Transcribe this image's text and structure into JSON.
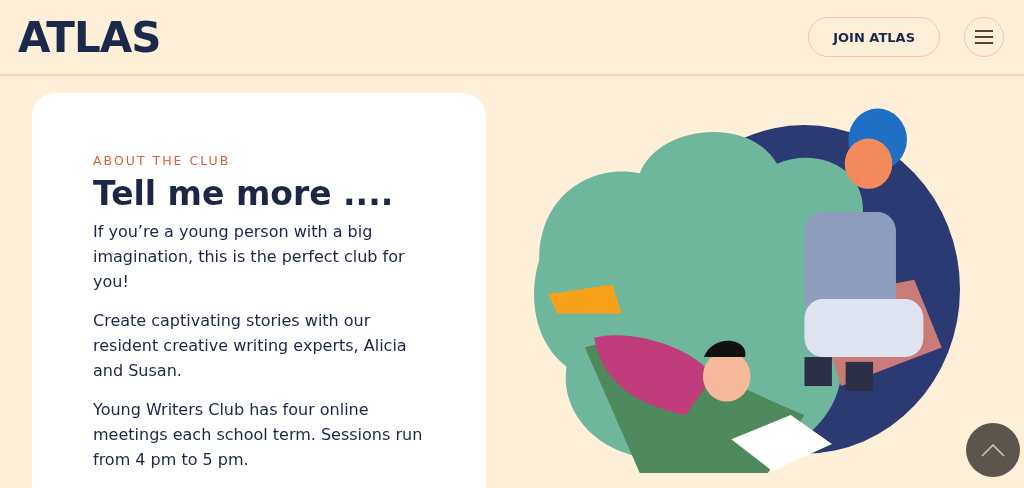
{
  "header": {
    "logo": "ATLAS",
    "join_button": "JOIN ATLAS"
  },
  "about": {
    "eyebrow": "ABOUT THE CLUB",
    "heading": "Tell me more ....",
    "paragraphs": [
      "If you’re a young person with a big imagination, this is the perfect club for you!",
      "Create captivating stories with our resident creative writing experts, Alicia and Susan.",
      "Young Writers Club has four online meetings each school term. Sessions run from 4 pm to 5 pm."
    ]
  }
}
